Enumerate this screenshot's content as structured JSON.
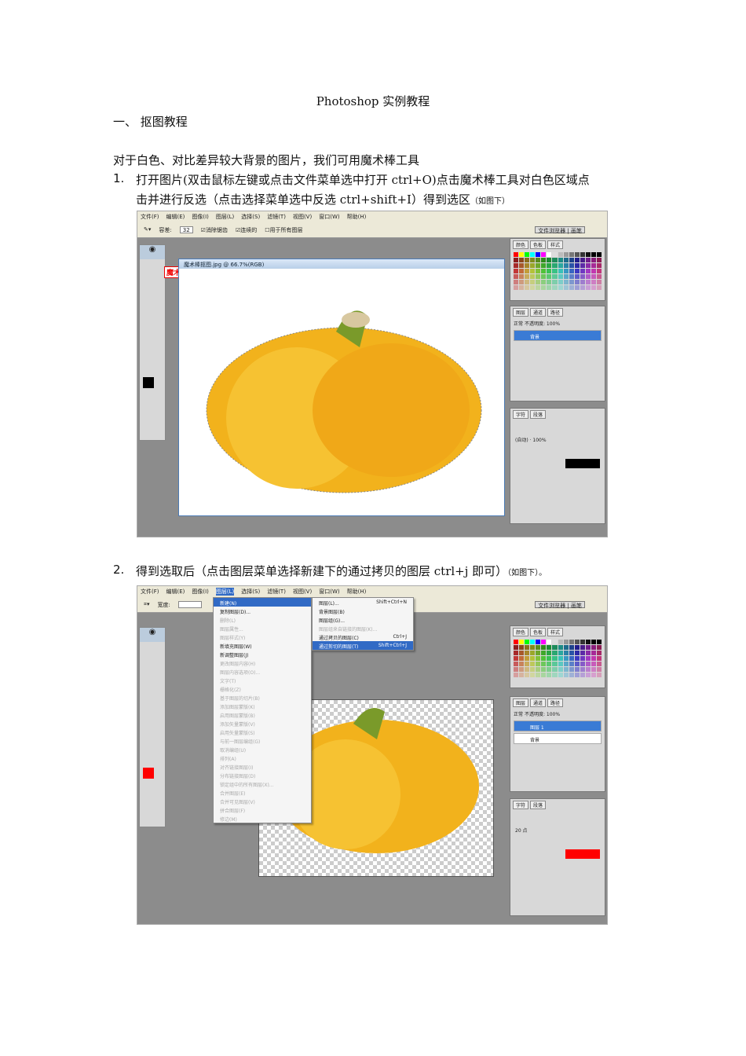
{
  "doc": {
    "title": "Photoshop 实例教程",
    "section": "一、 抠图教程",
    "intro": "对于白色、对比差异较大背景的图片，我们可用魔术棒工具",
    "step1_num": "1.",
    "step1_line1": "打开图片(双击鼠标左键或点击文件菜单选中打开  ctrl+O)点击魔术棒工具对白色区域点",
    "step1_line2": "击并进行反选（点击选择菜单选中反选 ctrl+shift+I）得到选区",
    "step1_note": "（如图下）",
    "step2_num": "2.",
    "step2_text": "得到选取后（点击图层菜单选择新建下的通过拷贝的图层 ctrl+j 即可）",
    "step2_note": "（如图下）。"
  },
  "ps": {
    "menus": [
      "文件(F)",
      "编辑(E)",
      "图像(I)",
      "图层(L)",
      "选择(S)",
      "滤镜(T)",
      "视图(V)",
      "窗口(W)",
      "帮助(H)"
    ],
    "tolerance_label": "容差:",
    "tolerance": "32",
    "antialias": "消除锯齿",
    "contiguous": "连续的",
    "all_layers": "用于所有图层",
    "width_label": "宽度:",
    "palette_tabs": [
      "文件浏览器",
      "画笔"
    ],
    "color_tabs": [
      "颜色",
      "色板",
      "样式"
    ],
    "layer_tabs": [
      "图层",
      "通道",
      "路径"
    ],
    "char_tabs": [
      "字符",
      "段落"
    ],
    "blend": "正常",
    "opacity_label": "不透明度:",
    "opacity": "100%",
    "window_title": "魔术棒抠图.jpg @ 66.7%(RGB)",
    "tool_callout": "魔术棒工具",
    "layer_bg": "背景",
    "layer_1": "图层 1",
    "font_size": "20 点",
    "leading": "(自动)",
    "scale": "100%",
    "layer_menu": [
      {
        "label": "新建(N)",
        "hl": true
      },
      {
        "label": "复制图层(D)..."
      },
      {
        "label": "删除(L)",
        "dis": true
      },
      {
        "label": "图层属性...",
        "dis": true
      },
      {
        "label": "图层样式(Y)",
        "dis": true
      },
      {
        "label": "新填充图层(W)"
      },
      {
        "label": "新调整图层(J)"
      },
      {
        "label": "更改图层内容(H)",
        "dis": true
      },
      {
        "label": "图层内容选项(O)...",
        "dis": true
      },
      {
        "label": "文字(T)",
        "dis": true
      },
      {
        "label": "栅格化(Z)",
        "dis": true
      },
      {
        "label": "基于图层的切片(B)",
        "dis": true
      },
      {
        "label": "添加图层蒙版(K)",
        "dis": true
      },
      {
        "label": "启用图层蒙版(B)",
        "dis": true
      },
      {
        "label": "添加矢量蒙版(V)",
        "dis": true
      },
      {
        "label": "启用矢量蒙版(S)",
        "dis": true
      },
      {
        "label": "与前一图层编组(G)",
        "dis": true
      },
      {
        "label": "取消编组(U)",
        "dis": true
      },
      {
        "label": "排列(A)",
        "dis": true
      },
      {
        "label": "对齐链接图层(I)",
        "dis": true
      },
      {
        "label": "分布链接图层(D)",
        "dis": true
      },
      {
        "label": "锁定组中的所有图层(X)...",
        "dis": true
      },
      {
        "label": "合并图层(E)",
        "dis": true
      },
      {
        "label": "合并可见图层(V)",
        "dis": true
      },
      {
        "label": "拼合图层(F)",
        "dis": true
      },
      {
        "label": "修边(M)",
        "dis": true
      }
    ],
    "new_submenu": [
      {
        "label": "图层(L)...",
        "key": "Shift+Ctrl+N"
      },
      {
        "label": "背景图层(B)",
        "key": ""
      },
      {
        "label": "图层组(G)...",
        "key": ""
      },
      {
        "label": "图层组来自链接的图层(K)...",
        "key": "",
        "dis": true
      },
      {
        "label": "通过拷贝的图层(C)",
        "key": "Ctrl+J"
      },
      {
        "label": "通过剪切的图层(T)",
        "key": "Shift+Ctrl+J",
        "hl": true
      }
    ]
  }
}
